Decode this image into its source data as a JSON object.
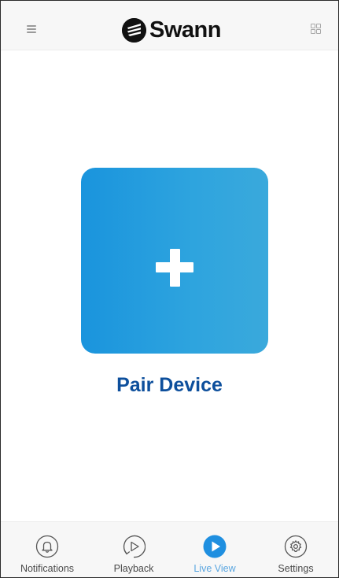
{
  "header": {
    "brand": "Swann",
    "menu_icon": "hamburger-menu-icon",
    "layout_icon": "grid-layout-icon"
  },
  "main": {
    "pair_tile_icon": "plus-icon",
    "pair_label": "Pair Device"
  },
  "bottom_nav": {
    "active": "Live View",
    "items": [
      {
        "label": "Notifications",
        "icon": "bell-icon"
      },
      {
        "label": "Playback",
        "icon": "playback-icon"
      },
      {
        "label": "Live View",
        "icon": "play-icon"
      },
      {
        "label": "Settings",
        "icon": "gear-icon"
      }
    ]
  },
  "colors": {
    "accent": "#1a94dd",
    "pair_label": "#0d4f9c",
    "active_tab": "#5aa6e0",
    "inactive_tab": "#4a4a4a"
  }
}
